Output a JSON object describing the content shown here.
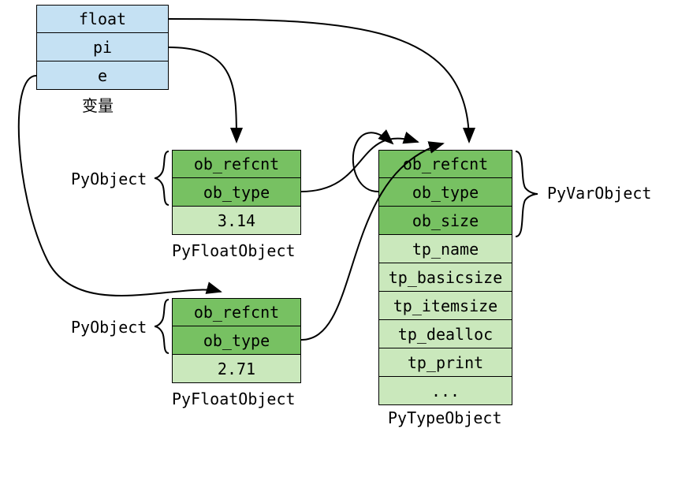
{
  "vars": {
    "cells": [
      "float",
      "pi",
      "e"
    ],
    "caption": "变量"
  },
  "pi_obj": {
    "cells": [
      "ob_refcnt",
      "ob_type",
      "3.14"
    ],
    "caption": "PyFloatObject"
  },
  "e_obj": {
    "cells": [
      "ob_refcnt",
      "ob_type",
      "2.71"
    ],
    "caption": "PyFloatObject"
  },
  "type_obj": {
    "cells": [
      "ob_refcnt",
      "ob_type",
      "ob_size",
      "tp_name",
      "tp_basicsize",
      "tp_itemsize",
      "tp_dealloc",
      "tp_print",
      "..."
    ],
    "caption": "PyTypeObject"
  },
  "brace_labels": {
    "pyobject_pi": "PyObject",
    "pyobject_e": "PyObject",
    "pyvarobject": "PyVarObject"
  }
}
